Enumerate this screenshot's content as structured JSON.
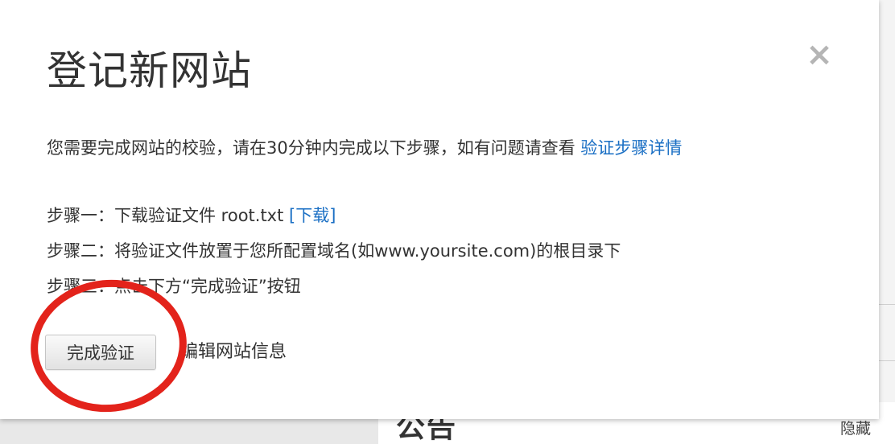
{
  "background": {
    "notice_title": "公告",
    "hide_label": "隐藏"
  },
  "dialog": {
    "title": "登记新网站",
    "close_glyph": "×",
    "intro_text": "您需要完成网站的校验，请在30分钟内完成以下步骤，如有问题请查看 ",
    "intro_link": "验证步骤详情",
    "steps": [
      {
        "prefix": "步骤一：",
        "text": "下载验证文件 root.txt ",
        "link": "[下载]"
      },
      {
        "prefix": "步骤二：",
        "text": "将验证文件放置于您所配置域名(如www.yoursite.com)的根目录下",
        "link": ""
      },
      {
        "prefix": "步骤三：",
        "text": "点击下方“完成验证”按钮",
        "link": ""
      }
    ],
    "finish_button": "完成验证",
    "edit_link": "编辑网站信息"
  },
  "colors": {
    "link": "#1a6fc4",
    "annotation_ring": "#e3231b"
  },
  "icons": {
    "close": "close-icon"
  }
}
